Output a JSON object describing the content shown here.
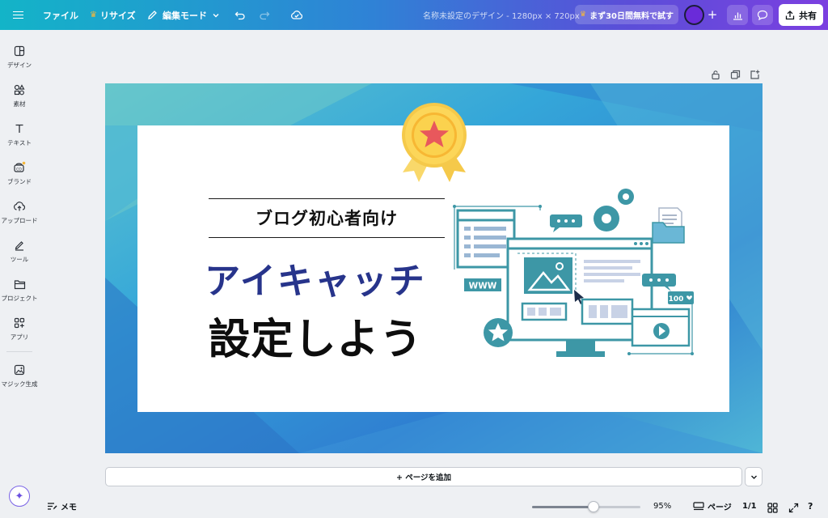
{
  "topbar": {
    "file_label": "ファイル",
    "resize_label": "リサイズ",
    "edit_mode_label": "編集モード",
    "doc_title": "名称未設定のデザイン - 1280px × 720px",
    "trial_label": "まず30日間無料で試す",
    "share_label": "共有"
  },
  "sidebar": {
    "items": [
      {
        "label": "デザイン",
        "icon": "layout-icon"
      },
      {
        "label": "素材",
        "icon": "shapes-icon"
      },
      {
        "label": "テキスト",
        "icon": "text-icon"
      },
      {
        "label": "ブランド",
        "icon": "brand-icon"
      },
      {
        "label": "アップロード",
        "icon": "upload-icon"
      },
      {
        "label": "ツール",
        "icon": "draw-icon"
      },
      {
        "label": "プロジェクト",
        "icon": "folder-icon"
      },
      {
        "label": "アプリ",
        "icon": "apps-icon"
      },
      {
        "label": "マジック生成",
        "icon": "magic-media-icon"
      }
    ]
  },
  "canvas": {
    "subtitle": "ブログ初心者向け",
    "title_line1": "アイキャッチ",
    "title_line2": "設定しよう",
    "title1_color": "#27348b",
    "badge_label": "100",
    "www_label": "WWW"
  },
  "add_page_label": "+ ページを追加",
  "bottombar": {
    "memo_label": "メモ",
    "zoom_value": "95%",
    "zoom_fraction": 0.57,
    "pages_label": "ページ",
    "page_count": "1/1"
  },
  "colors": {
    "accent": "#13b4c8",
    "brand_purple": "#7b3fe0",
    "illustration_teal": "#3d97a6"
  }
}
